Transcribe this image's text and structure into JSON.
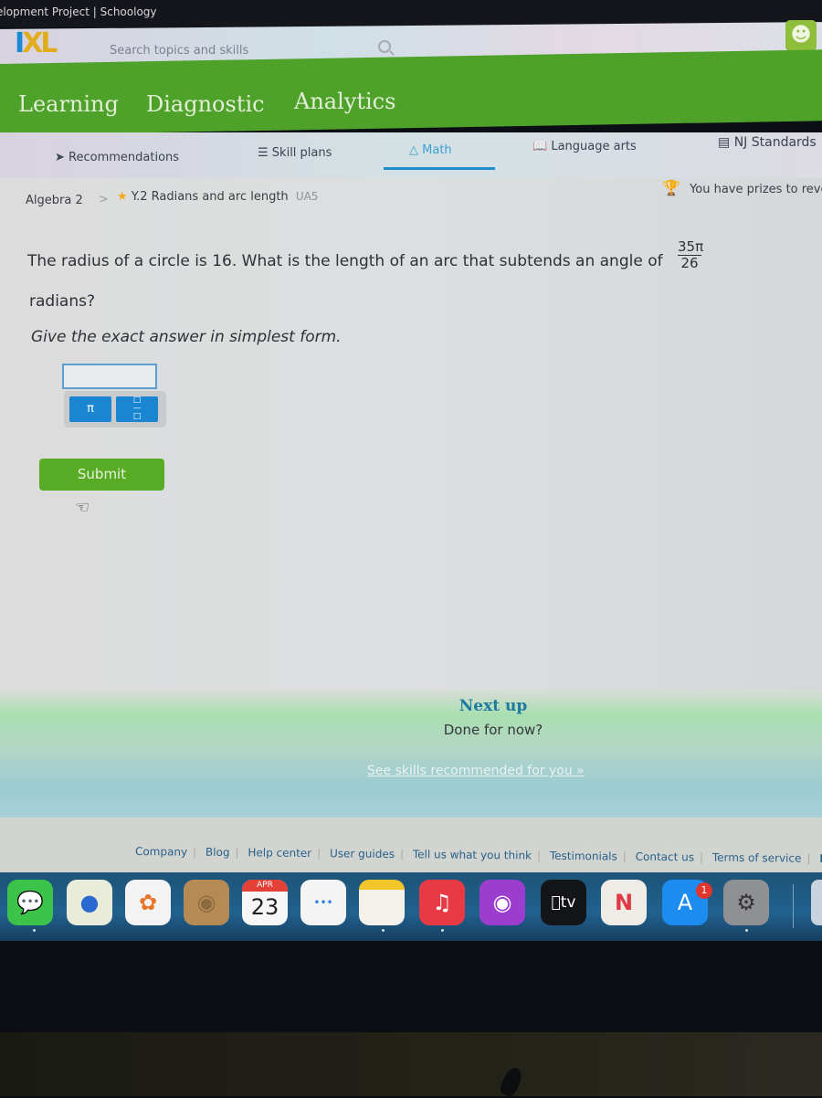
{
  "browser": {
    "tab_title": "elopment Project | Schoology"
  },
  "header": {
    "logo": {
      "i": "I",
      "xl": "XL"
    },
    "search_placeholder": "Search topics and skills",
    "user_icon": "person-icon"
  },
  "main_nav": [
    {
      "label": "Learning",
      "active": true
    },
    {
      "label": "Diagnostic",
      "active": false
    },
    {
      "label": "Analytics",
      "active": false
    }
  ],
  "sub_nav": [
    {
      "label": "Recommendations",
      "icon": "signpost-icon"
    },
    {
      "label": "Skill plans",
      "icon": "skill-plan-icon"
    },
    {
      "label": "Math",
      "icon": "math-shapes-icon",
      "active": true
    },
    {
      "label": "Language arts",
      "icon": "book-icon"
    },
    {
      "label": "NJ Standards",
      "icon": "clipboard-icon"
    }
  ],
  "breadcrumb": {
    "subject": "Algebra 2",
    "separator": ">",
    "skill": "Y.2 Radians and arc length",
    "code": "UA5"
  },
  "prizes": {
    "text": "You have prizes to reveal"
  },
  "question": {
    "line1": "The radius of a circle is 16. What is the length of an arc that subtends an angle of",
    "fraction": {
      "numerator": "35π",
      "denominator": "26"
    },
    "line2": "radians?",
    "instruction": "Give the exact answer in simplest form."
  },
  "answer": {
    "value": "",
    "keys": [
      "π",
      "fraction"
    ]
  },
  "submit_label": "Submit",
  "next_up": {
    "title": "Next up",
    "subtitle": "Done for now?",
    "link": "See skills recommended for you »"
  },
  "footer_links": [
    "Company",
    "Blog",
    "Help center",
    "User guides",
    "Tell us what you think",
    "Testimonials",
    "Contact us",
    "Terms of service",
    "Privacy"
  ],
  "dock": {
    "apps": [
      "Messages",
      "Maps",
      "Photos",
      "Contacts",
      "Calendar",
      "Reminders",
      "Notes",
      "Music",
      "Podcasts",
      "Apple TV",
      "News",
      "App Store",
      "System Preferences"
    ],
    "calendar": {
      "month": "APR",
      "day": "23"
    },
    "tv_label": "tv",
    "app_store_badge": "1"
  }
}
